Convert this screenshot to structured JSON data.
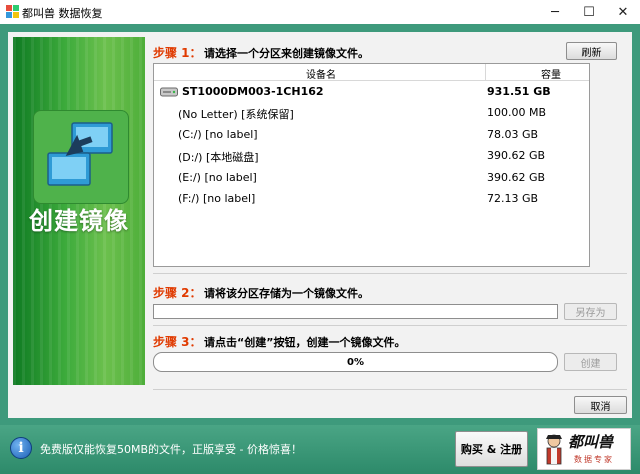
{
  "window": {
    "title": "都叫兽 数据恢复",
    "minimize_glyph": "─",
    "maximize_glyph": "☐",
    "close_glyph": "✕"
  },
  "banner": {
    "title": "创建镜像",
    "icon": "disk-image-icon"
  },
  "step1": {
    "label": "步骤 1：",
    "text": "请选择一个分区来创建镜像文件。",
    "refresh_label": "刷新"
  },
  "table": {
    "headers": [
      "设备名",
      "容量"
    ],
    "disk": {
      "name": "ST1000DM003-1CH162",
      "capacity": "931.51 GB",
      "icon": "hard-drive-icon"
    },
    "partitions": [
      {
        "name": "(No Letter) [系统保留]",
        "capacity": "100.00 MB"
      },
      {
        "name": "(C:/) [no label]",
        "capacity": "78.03 GB"
      },
      {
        "name": "(D:/) [本地磁盘]",
        "capacity": "390.62 GB"
      },
      {
        "name": "(E:/) [no label]",
        "capacity": "390.62 GB"
      },
      {
        "name": "(F:/) [no label]",
        "capacity": "72.13 GB"
      }
    ]
  },
  "step2": {
    "label": "步骤 2：",
    "text": "请将该分区存储为一个镜像文件。",
    "path_value": "",
    "save_as_label": "另存为"
  },
  "step3": {
    "label": "步骤 3：",
    "text": "请点击“创建”按钮，创建一个镜像文件。",
    "progress": "0%",
    "create_label": "创建"
  },
  "cancel_label": "取消",
  "footer": {
    "info_glyph": "i",
    "notice": "免费版仅能恢复50MB的文件，正版享受 - 价格惊喜！",
    "buy_label": "购买 & 注册",
    "logo_title": "都叫兽",
    "logo_sub": "数据专家"
  },
  "colors": {
    "frame": "#3e9a7c",
    "step_accent": "#e03a00",
    "banner_green": "#3dab3c"
  }
}
